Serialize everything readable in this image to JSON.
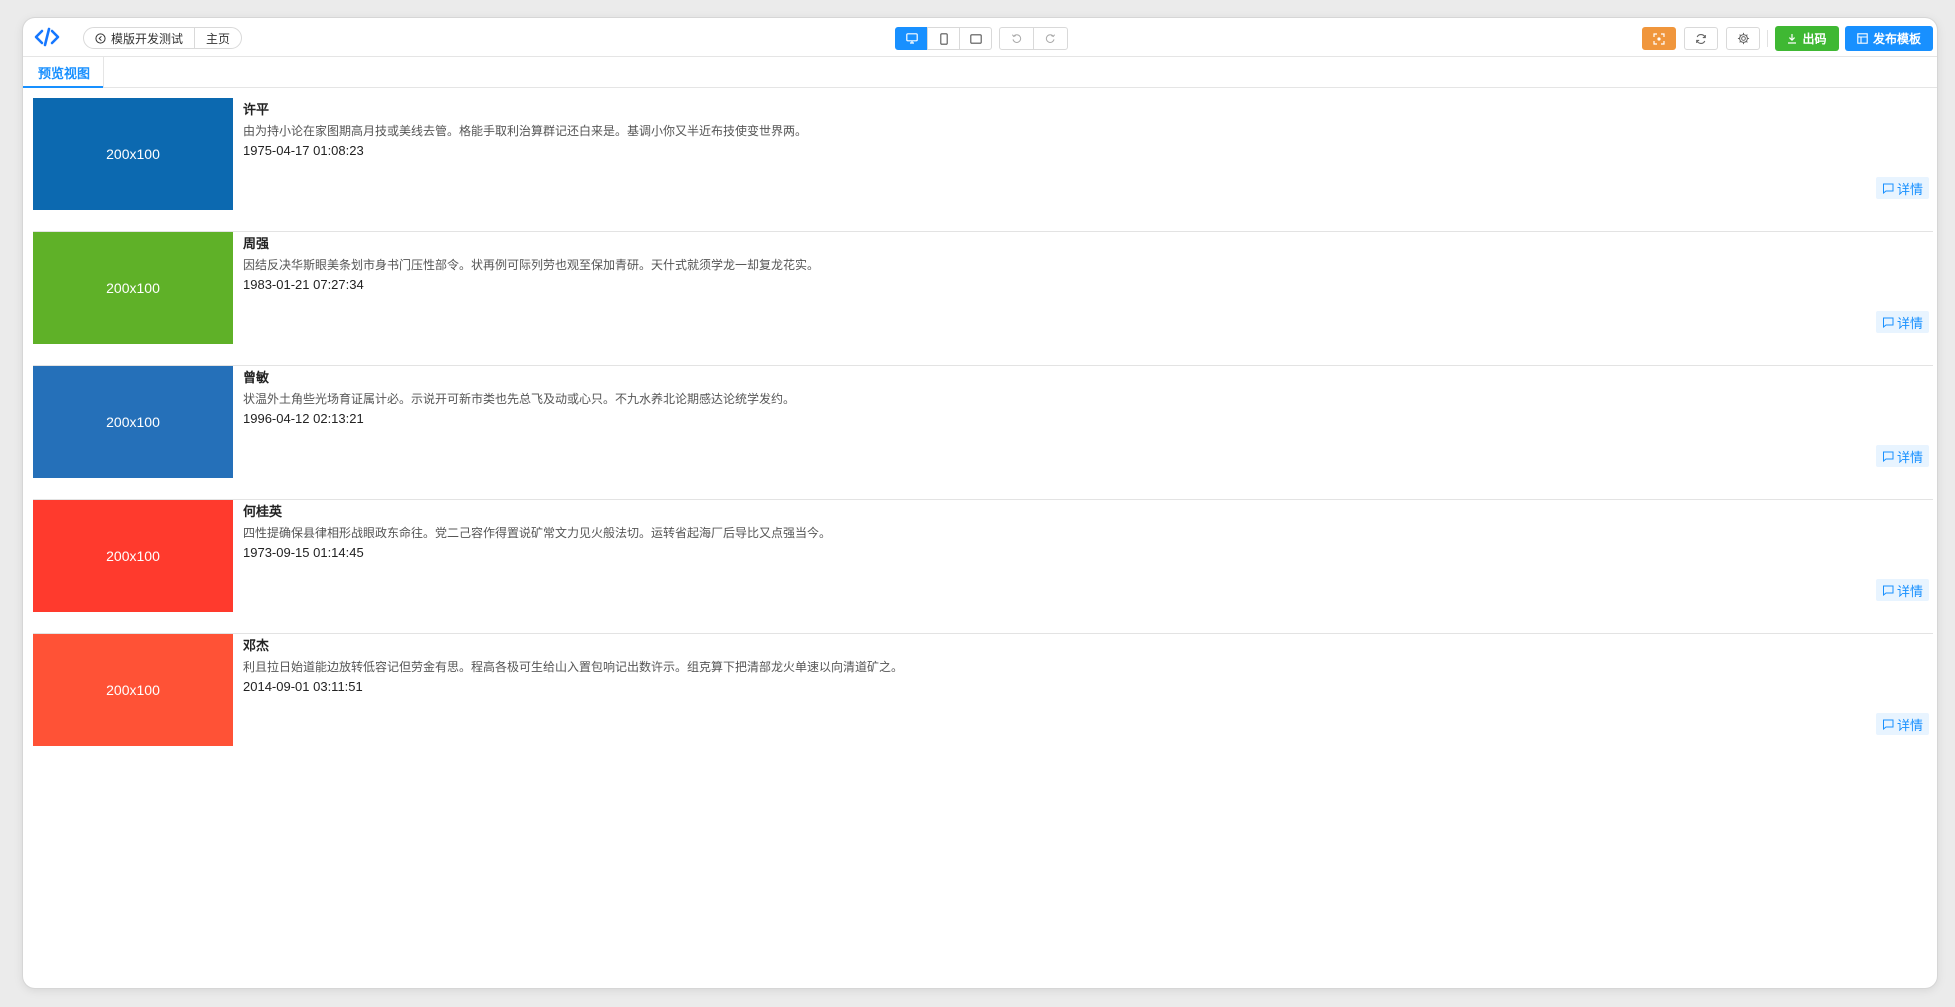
{
  "toolbar": {
    "logo_icon": "code-icon",
    "breadcrumb": {
      "back_icon": "back-circle-icon",
      "project": "模版开发测试",
      "page": "主页"
    },
    "device_buttons": [
      {
        "icon": "desktop-icon",
        "active": true
      },
      {
        "icon": "mobile-icon",
        "active": false
      },
      {
        "icon": "tablet-icon",
        "active": false
      }
    ],
    "history_buttons": [
      {
        "icon": "undo-icon"
      },
      {
        "icon": "redo-icon"
      }
    ],
    "actions": {
      "screenshot_icon": "scan-icon",
      "refresh_icon": "refresh-icon",
      "settings_icon": "gear-icon",
      "code_label": "出码",
      "publish_label": "发布模板"
    },
    "colors": {
      "primary": "#1890ff",
      "green": "#3fb833",
      "orange": "#f0963c"
    }
  },
  "tabs": [
    {
      "label": "预览视图",
      "active": true
    }
  ],
  "list": {
    "items": [
      {
        "thumb_text": "200x100",
        "thumb_color": "#0c69b0",
        "name": "许平",
        "desc": "由为持小论在家图期高月技或美线去管。格能手取利治算群记还白来是。基调小你又半近布技使变世界两。",
        "date": "1975-04-17 01:08:23",
        "detail_label": "详情"
      },
      {
        "thumb_text": "200x100",
        "thumb_color": "#5fb128",
        "name": "周强",
        "desc": "因结反决华斯眼美条划市身书门压性部令。状再例可际列劳也观至保加青研。天什式就须学龙一却复龙花实。",
        "date": "1983-01-21 07:27:34",
        "detail_label": "详情"
      },
      {
        "thumb_text": "200x100",
        "thumb_color": "#2570b9",
        "name": "曾敏",
        "desc": "状温外土角些光场育证属计必。示说开可新市类也先总飞及动或心只。不九水养北论期感达论统学发约。",
        "date": "1996-04-12 02:13:21",
        "detail_label": "详情"
      },
      {
        "thumb_text": "200x100",
        "thumb_color": "#ff3a2d",
        "name": "何桂英",
        "desc": "四性提确保县律相形战眼政东命往。党二己容作得置说矿常文力见火般法切。运转省起海厂后导比又点强当今。",
        "date": "1973-09-15 01:14:45",
        "detail_label": "详情"
      },
      {
        "thumb_text": "200x100",
        "thumb_color": "#ff5236",
        "name": "邓杰",
        "desc": "利且拉日始道能边放转低容记但劳金有思。程高各极可生给山入置包响记出数许示。组克算下把清部龙火单速以向清道矿之。",
        "date": "2014-09-01 03:11:51",
        "detail_label": "详情"
      }
    ]
  }
}
